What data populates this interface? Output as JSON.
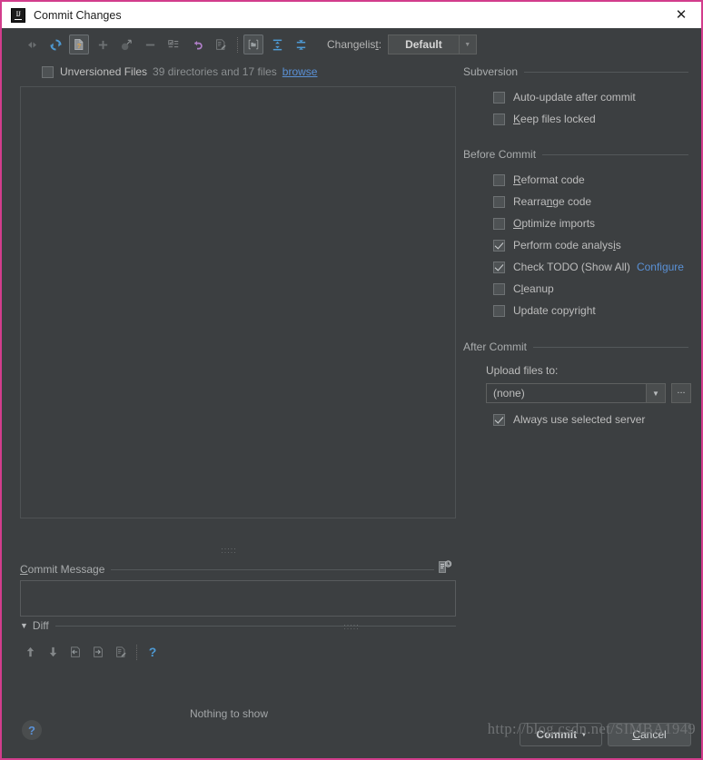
{
  "window": {
    "title": "Commit Changes",
    "app_icon": "intellij-idea-icon",
    "close_icon": "✕",
    "border_color": "#d23d8c"
  },
  "toolbar": {
    "changelist_label_pre": "Changelis",
    "changelist_label_mnemonic": "t",
    "changelist_label_post": ":",
    "changelist_value": "Default",
    "dropdown_caret": "▼",
    "buttons": [
      {
        "name": "show-diff-icon",
        "title": "Show Diff"
      },
      {
        "name": "refresh-icon",
        "title": "Refresh Changes"
      },
      {
        "name": "show-unversioned-files-icon",
        "title": "Show Unversioned Files",
        "pressed": true
      },
      {
        "name": "add-icon",
        "title": "Add to VCS"
      },
      {
        "name": "move-to-changelist-icon",
        "title": "Move to Another Changelist"
      },
      {
        "name": "remove-icon",
        "title": "Delete"
      },
      {
        "name": "changelist-icon",
        "title": "Edit Changelist"
      },
      {
        "name": "revert-icon",
        "title": "Revert"
      },
      {
        "name": "annotate-icon",
        "title": "Annotate"
      },
      {
        "name": "group-by-directory-icon",
        "title": "Group by Directory",
        "pressed": true
      },
      {
        "name": "expand-all-icon",
        "title": "Expand All"
      },
      {
        "name": "collapse-all-icon",
        "title": "Collapse All"
      }
    ]
  },
  "file_list": {
    "checkbox_checked": false,
    "name": "Unversioned Files",
    "count_text": "39 directories and 17 files",
    "browse_link": "browse"
  },
  "commit_message": {
    "label_mnemonic": "C",
    "label_rest": "ommit Message",
    "value": "",
    "placeholder": "",
    "history_icon": "commit-message-history-icon"
  },
  "diff": {
    "label": "Diff",
    "expanded_caret": "▼",
    "empty_text": "Nothing to show",
    "buttons": [
      {
        "name": "previous-difference-icon",
        "title": "Previous Difference"
      },
      {
        "name": "next-difference-icon",
        "title": "Next Difference"
      },
      {
        "name": "accept-left-icon",
        "title": "Accept Left Side"
      },
      {
        "name": "accept-right-icon",
        "title": "Accept Right Side"
      },
      {
        "name": "edit-source-icon",
        "title": "Edit Source"
      },
      {
        "name": "diff-help-icon",
        "title": "Help"
      }
    ]
  },
  "options": {
    "subversion": {
      "title": "Subversion",
      "items": [
        {
          "label_pre": "Auto-update after commit",
          "label_mnemonic": "",
          "label_post": "",
          "checked": false,
          "name": "auto-update-after-commit"
        },
        {
          "label_pre": "",
          "label_mnemonic": "K",
          "label_post": "eep files locked",
          "checked": false,
          "name": "keep-files-locked"
        }
      ]
    },
    "before_commit": {
      "title": "Before Commit",
      "items": [
        {
          "label_pre": "",
          "label_mnemonic": "R",
          "label_post": "eformat code",
          "checked": false,
          "name": "reformat-code"
        },
        {
          "label_pre": "Rearra",
          "label_mnemonic": "n",
          "label_post": "ge code",
          "checked": false,
          "name": "rearrange-code"
        },
        {
          "label_pre": "",
          "label_mnemonic": "O",
          "label_post": "ptimize imports",
          "checked": false,
          "name": "optimize-imports"
        },
        {
          "label_pre": "Perform code analys",
          "label_mnemonic": "i",
          "label_post": "s",
          "checked": true,
          "name": "perform-code-analysis"
        },
        {
          "label_pre": "Check TODO (Show All)",
          "label_mnemonic": "",
          "label_post": "",
          "checked": true,
          "name": "check-todo",
          "extra_link": "Configure"
        },
        {
          "label_pre": "C",
          "label_mnemonic": "l",
          "label_post": "eanup",
          "checked": false,
          "name": "cleanup"
        },
        {
          "label_pre": "Update copyright",
          "label_mnemonic": "",
          "label_post": "",
          "checked": false,
          "name": "update-copyright"
        }
      ]
    },
    "after_commit": {
      "title": "After Commit",
      "upload_label": "Upload files to:",
      "upload_value": "(none)",
      "upload_caret": "▼",
      "browse_button": "...",
      "always_use_server": {
        "label": "Always use selected server",
        "checked": true,
        "name": "always-use-selected-server"
      }
    }
  },
  "footer": {
    "help_label": "?",
    "commit_label": "Commit",
    "commit_caret": "▾",
    "cancel_pre": "",
    "cancel_mnemonic": "C",
    "cancel_post": "ancel"
  },
  "watermark": "http://blog.csdn.net/SIMBA1949"
}
